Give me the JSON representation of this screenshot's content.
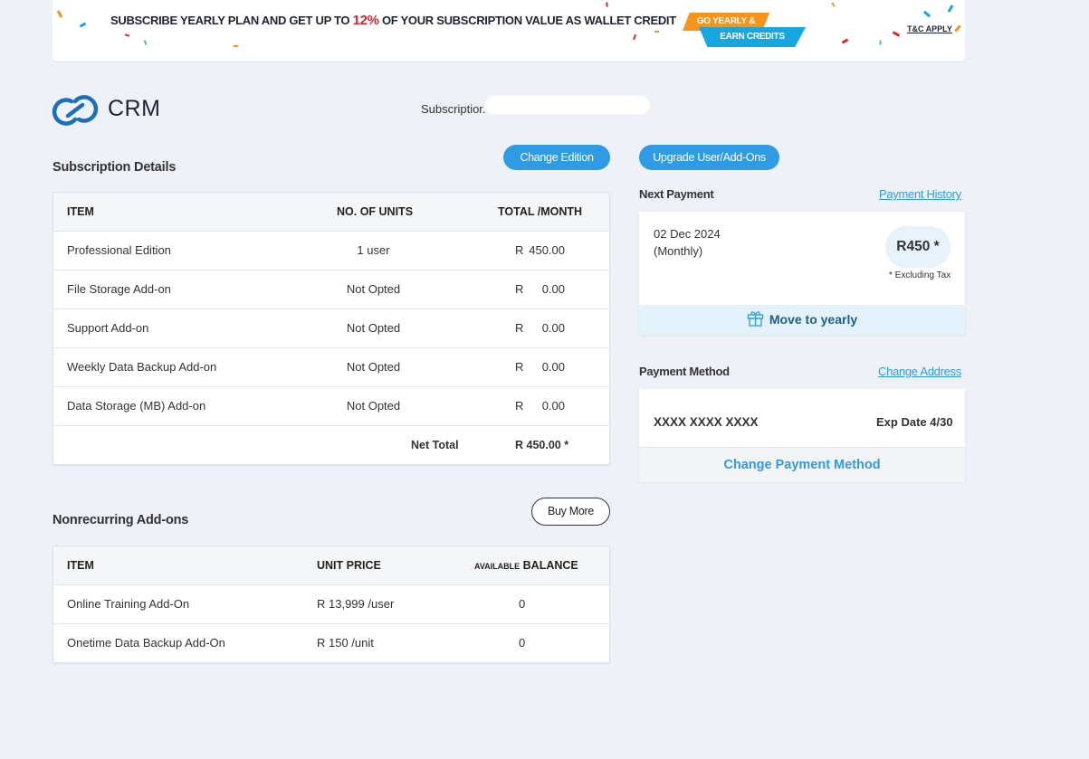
{
  "banner": {
    "text_before": "SUBSCRIBE YEARLY PLAN AND GET UP TO ",
    "percent": "12%",
    "text_after": " OF YOUR SUBSCRIPTION VALUE AS WALLET CREDIT",
    "promo_line1": "GO YEARLY &",
    "promo_line2": "EARN CREDITS",
    "terms": "T&C APPLY"
  },
  "header": {
    "product": "CRM",
    "subscription_label": "Subscriptior."
  },
  "subscription": {
    "title": "Subscription Details",
    "change_edition": "Change Edition",
    "upgrade": "Upgrade User/Add-Ons",
    "columns": [
      "ITEM",
      "NO. OF UNITS",
      "TOTAL /MONTH"
    ],
    "rows": [
      {
        "item": "Professional Edition",
        "units": "1 user",
        "currency": "R",
        "amount": "450.00"
      },
      {
        "item": "File Storage Add-on",
        "units": "Not Opted",
        "currency": "R",
        "amount": "0.00"
      },
      {
        "item": "Support Add-on",
        "units": "Not Opted",
        "currency": "R",
        "amount": "0.00"
      },
      {
        "item": "Weekly Data Backup Add-on",
        "units": "Not Opted",
        "currency": "R",
        "amount": "0.00"
      },
      {
        "item": "Data Storage (MB) Add-on",
        "units": "Not Opted",
        "currency": "R",
        "amount": "0.00"
      }
    ],
    "net_total_label": "Net Total",
    "net_total_value": "R 450.00 *"
  },
  "nonrecurring": {
    "title": "Nonrecurring Add-ons",
    "buy_more": "Buy More",
    "col_item": "ITEM",
    "col_unit_price": "UNIT PRICE",
    "col_available": "AVAILABLE",
    "col_balance": " BALANCE",
    "rows": [
      {
        "item": "Online Training Add-On",
        "price": "R 13,999 /user",
        "balance": "0"
      },
      {
        "item": "Onetime Data Backup Add-On",
        "price": "R 150 /unit",
        "balance": "0"
      }
    ]
  },
  "next_payment": {
    "label": "Next Payment",
    "history_link": "Payment History",
    "date": "02 Dec 2024",
    "cycle": "(Monthly)",
    "amount": "R450 *",
    "tax_note": "* Excluding Tax",
    "move_yearly": "Move to yearly"
  },
  "payment_method": {
    "label": "Payment Method",
    "change_address": "Change Address",
    "card_number": "XXXX XXXX XXXX",
    "expiry": "Exp Date 4/30",
    "change_method": "Change Payment Method"
  },
  "colors": {
    "accent": "#2f9be5",
    "banner_highlight": "#e2232a",
    "promo_orange": "#f7941d",
    "promo_blue": "#17a7e0"
  },
  "icons": [
    "crm-logo-icon",
    "gift-icon"
  ]
}
